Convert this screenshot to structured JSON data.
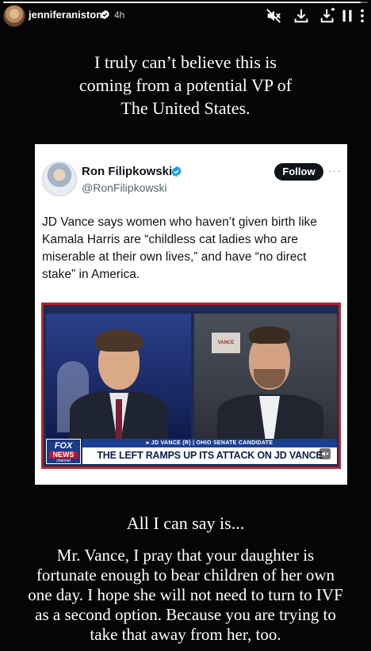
{
  "story": {
    "progress": 0.98,
    "username": "jenniferaniston",
    "time": "4h",
    "icons": [
      "mute-icon",
      "download-icon",
      "save-icon",
      "pause-icon",
      "more-icon"
    ]
  },
  "caption_top": "I truly can’t believe this is coming from a potential VP of The United States.",
  "tweet": {
    "name": "Ron Filipkowski",
    "handle": "@RonFilipkowski",
    "follow_label": "Follow",
    "more_label": "···",
    "text": "JD Vance says women who haven’t given birth like Kamala Harris are “childless cat ladies who are miserable at their own lives,” and have “no direct stake” in America.",
    "video": {
      "channel_line1": "FOX",
      "channel_line2": "NEWS",
      "channel_line3": "channel",
      "sign_text": "VANCE",
      "lower_third_top": "▸ JD VANCE (R) | OHIO SENATE CANDIDATE",
      "lower_third_main": "THE LEFT RAMPS UP ITS ATTACK ON JD VANCE"
    }
  },
  "caption_mid": "All I can say is...",
  "caption_bottom": "Mr. Vance, I pray that your daughter is fortunate enough to bear children of her own one day. I hope she will not need to turn to IVF as a second option. Because you are trying to take that away from her, too.",
  "colors": {
    "background": "#050505",
    "verified_blue": "#1d9bf0",
    "fox_red": "#b3262c",
    "fox_blue": "#1d3f8f"
  }
}
